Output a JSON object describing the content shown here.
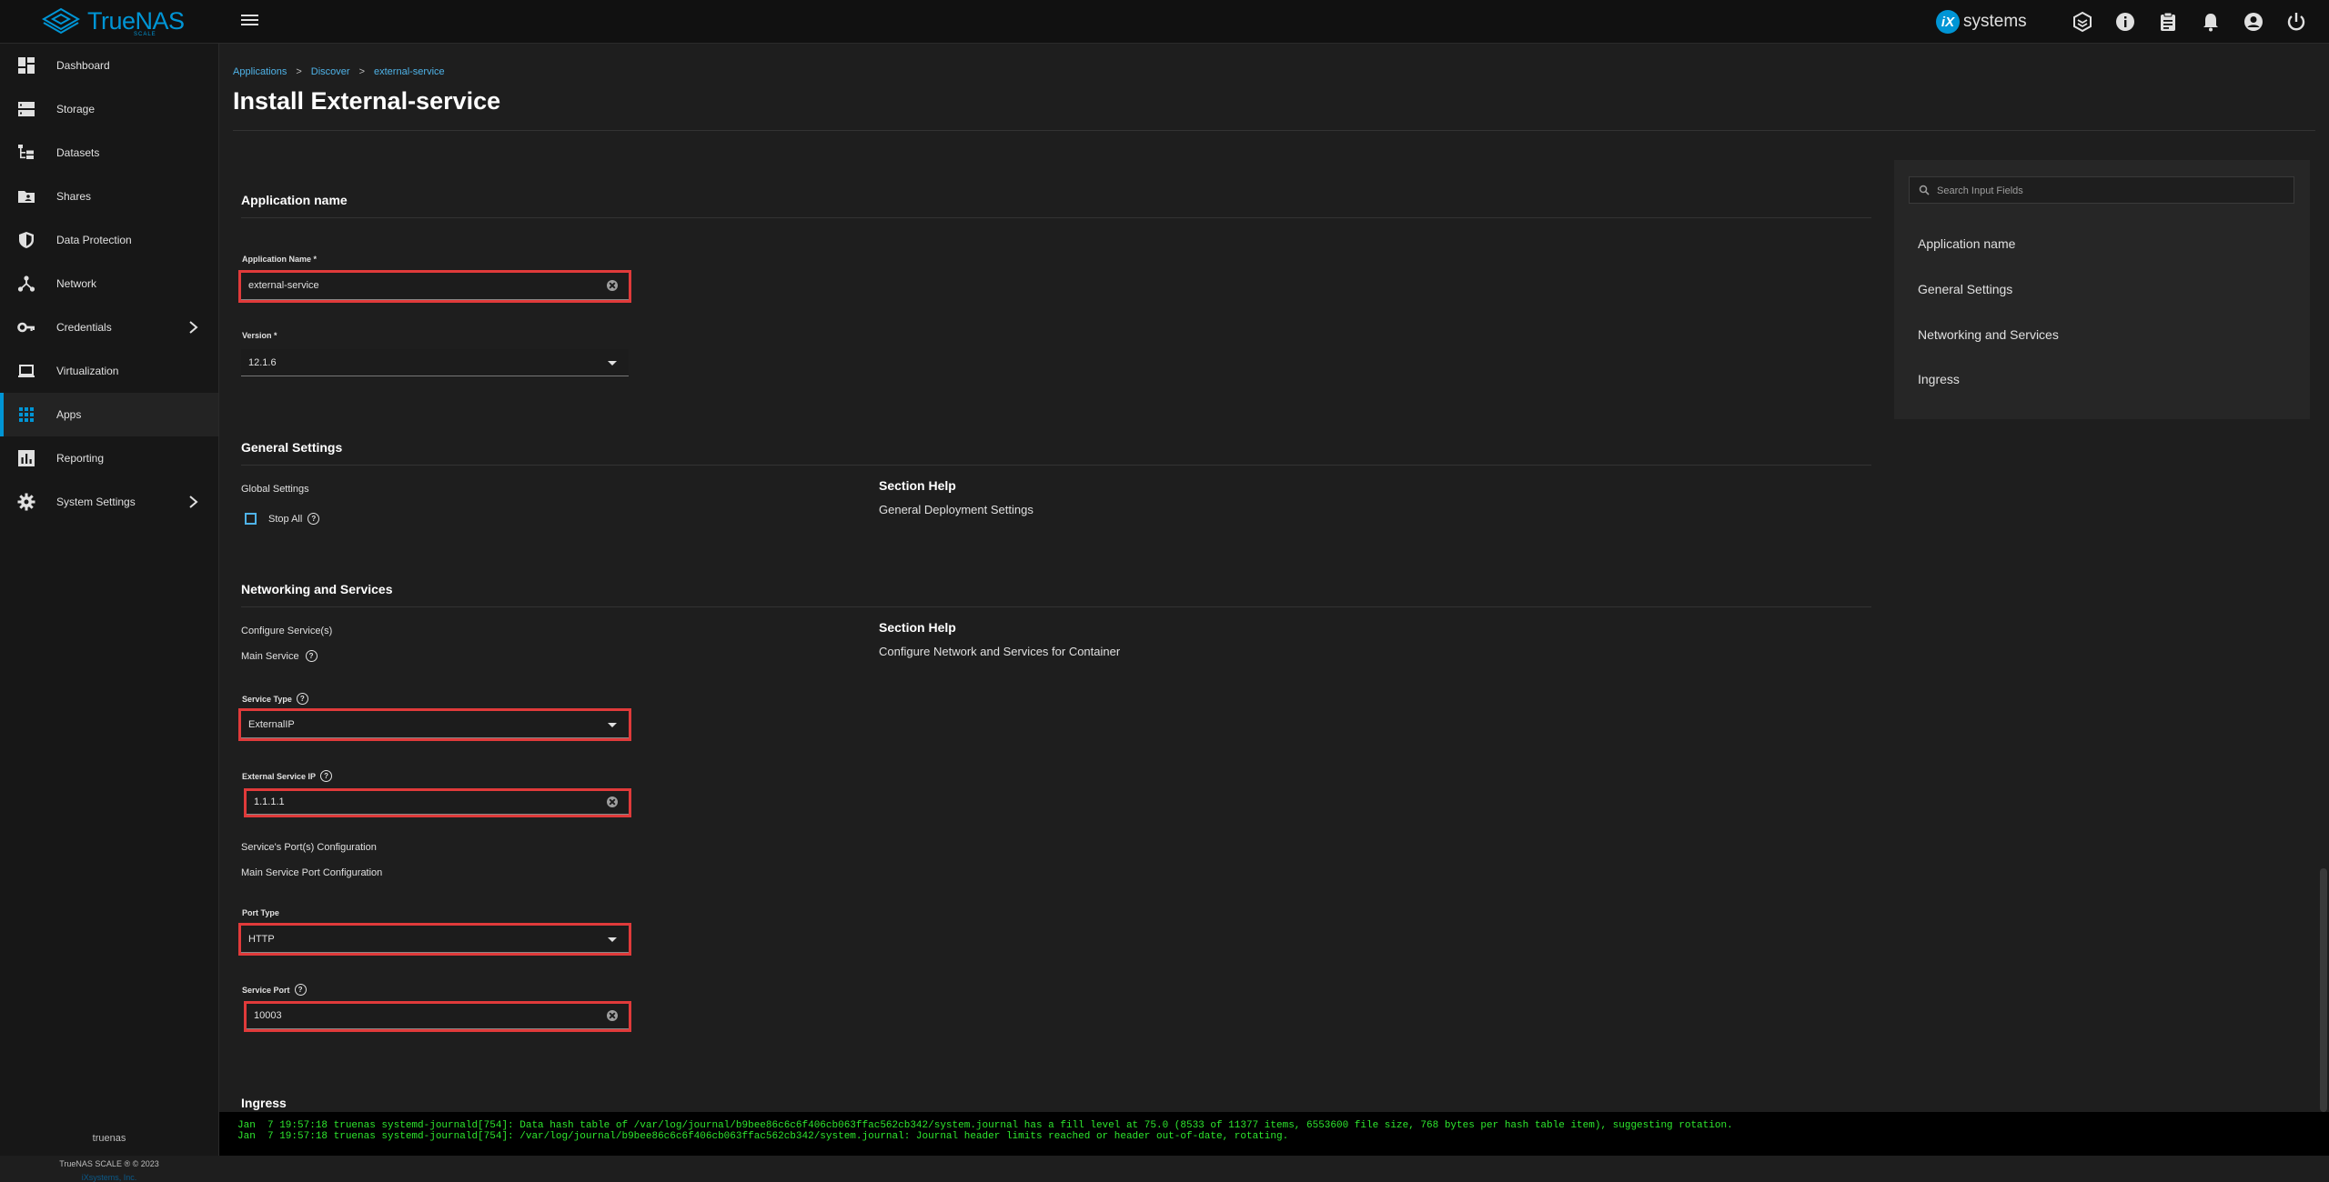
{
  "header": {
    "brand": "TrueNAS",
    "brand_sub": "SCALE",
    "vendor_mark": "iX",
    "vendor_text": "systems"
  },
  "sidebar": {
    "items": [
      {
        "label": "Dashboard",
        "icon": "dashboard-icon"
      },
      {
        "label": "Storage",
        "icon": "storage-icon"
      },
      {
        "label": "Datasets",
        "icon": "datasets-icon"
      },
      {
        "label": "Shares",
        "icon": "shares-icon"
      },
      {
        "label": "Data Protection",
        "icon": "shield-icon"
      },
      {
        "label": "Network",
        "icon": "network-icon"
      },
      {
        "label": "Credentials",
        "icon": "key-icon"
      },
      {
        "label": "Virtualization",
        "icon": "laptop-icon"
      },
      {
        "label": "Apps",
        "icon": "apps-grid-icon"
      },
      {
        "label": "Reporting",
        "icon": "chart-icon"
      },
      {
        "label": "System Settings",
        "icon": "gear-icon"
      }
    ],
    "hostname": "truenas",
    "copyright": "TrueNAS SCALE ® © 2023",
    "vendor_link": "iXsystems, Inc."
  },
  "breadcrumb": {
    "items": [
      "Applications",
      "Discover",
      "external-service"
    ],
    "separator": ">"
  },
  "page_title": "Install External-service",
  "form": {
    "app_name_section": "Application name",
    "app_name_label": "Application Name *",
    "app_name_value": "external-service",
    "version_label": "Version *",
    "version_value": "12.1.6",
    "general_section": "General Settings",
    "global_settings": "Global Settings",
    "stop_all_label": "Stop All",
    "general_help_title": "Section Help",
    "general_help_text": "General Deployment Settings",
    "networking_section": "Networking and Services",
    "configure_services": "Configure Service(s)",
    "main_service": "Main Service",
    "networking_help_title": "Section Help",
    "networking_help_text": "Configure Network and Services for Container",
    "service_type_label": "Service Type",
    "service_type_value": "ExternalIP",
    "external_ip_label": "External Service IP",
    "external_ip_value": "1.1.1.1",
    "port_config": "Service's Port(s) Configuration",
    "main_port_config": "Main Service Port Configuration",
    "port_type_label": "Port Type",
    "port_type_value": "HTTP",
    "service_port_label": "Service Port",
    "service_port_value": "10003",
    "ingress_section": "Ingress",
    "help_glyph": "?"
  },
  "side_panel": {
    "search_placeholder": "Search Input Fields",
    "links": [
      "Application name",
      "General Settings",
      "Networking and Services",
      "Ingress"
    ]
  },
  "console": {
    "lines": [
      "Jan  7 19:57:18 truenas systemd-journald[754]: Data hash table of /var/log/journal/b9bee86c6c6f406cb063ffac562cb342/system.journal has a fill level at 75.0 (8533 of 11377 items, 6553600 file size, 768 bytes per hash table item), suggesting rotation.",
      "Jan  7 19:57:18 truenas systemd-journald[754]: /var/log/journal/b9bee86c6c6f406cb063ffac562cb342/system.journal: Journal header limits reached or header out-of-date, rotating."
    ]
  },
  "colors": {
    "accent": "#0095d5",
    "highlight": "#e03a3a",
    "console_text": "#2ee82e"
  }
}
